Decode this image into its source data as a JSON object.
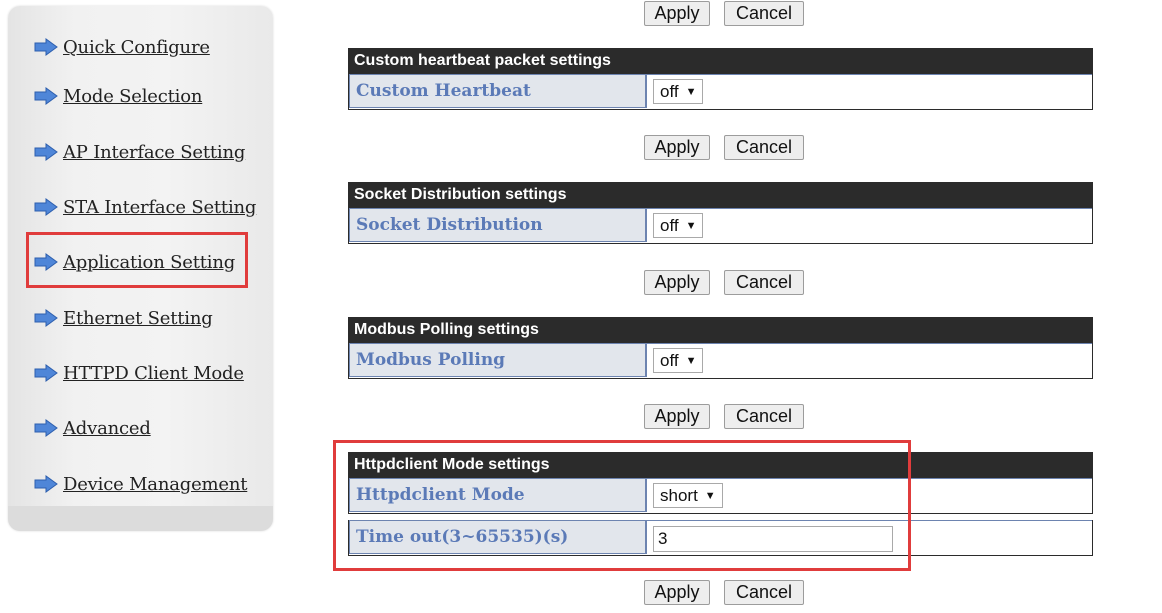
{
  "sidebar": {
    "items": [
      {
        "label": "Quick Configure"
      },
      {
        "label": "Mode Selection"
      },
      {
        "label": "AP Interface Setting"
      },
      {
        "label": "STA Interface Setting"
      },
      {
        "label": "Application Setting"
      },
      {
        "label": "Ethernet Setting"
      },
      {
        "label": "HTTPD Client Mode"
      },
      {
        "label": "Advanced"
      },
      {
        "label": "Device Management"
      }
    ],
    "selected": "Application Setting"
  },
  "buttons": {
    "apply": "Apply",
    "cancel": "Cancel"
  },
  "sections": {
    "heartbeat": {
      "title": "Custom heartbeat packet settings",
      "label": "Custom Heartbeat",
      "value": "off"
    },
    "socket": {
      "title": "Socket Distribution settings",
      "label": "Socket Distribution",
      "value": "off"
    },
    "modbus": {
      "title": "Modbus Polling settings",
      "label": "Modbus Polling",
      "value": "off"
    },
    "httpd": {
      "title": "Httpdclient Mode settings",
      "mode_label": "Httpdclient Mode",
      "mode_value": "short",
      "timeout_label": "Time out(3~65535)(s)",
      "timeout_value": "3"
    }
  },
  "colors": {
    "highlight": "#e03c3c",
    "header_bg": "#2b2b2b",
    "label_text": "#5b7ab7",
    "label_bg": "#e2e6ec"
  },
  "icons": {
    "nav": "blue-arrow-icon",
    "dropdown": "caret-down-icon"
  }
}
